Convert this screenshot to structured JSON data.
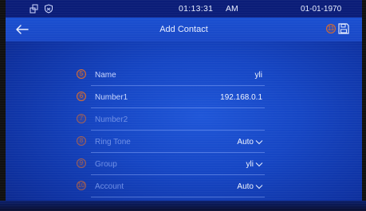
{
  "status_bar": {
    "time": "01:13:31",
    "ampm": "AM",
    "date": "01-01-1970",
    "icons": [
      "network-icon",
      "shield-icon"
    ]
  },
  "header": {
    "title": "Add Contact",
    "back_icon": "arrow-left-icon",
    "save_icon": "save-disk-icon",
    "save_callout": "11"
  },
  "form": {
    "fields": [
      {
        "callout": "5",
        "label": "Name",
        "value": "yli"
      },
      {
        "callout": "6",
        "label": "Number1",
        "value": "192.168.0.1"
      },
      {
        "callout": "7",
        "label": "Number2",
        "value": ""
      },
      {
        "callout": "8",
        "label": "Ring Tone",
        "value": "Auto"
      },
      {
        "callout": "9",
        "label": "Group",
        "value": "yli"
      },
      {
        "callout": "10",
        "label": "Account",
        "value": "Auto"
      }
    ]
  },
  "colors": {
    "background": "#1646c4",
    "status_bar": "#0b1d78",
    "callout": "#d86a2c",
    "text": "#e8eeff"
  }
}
